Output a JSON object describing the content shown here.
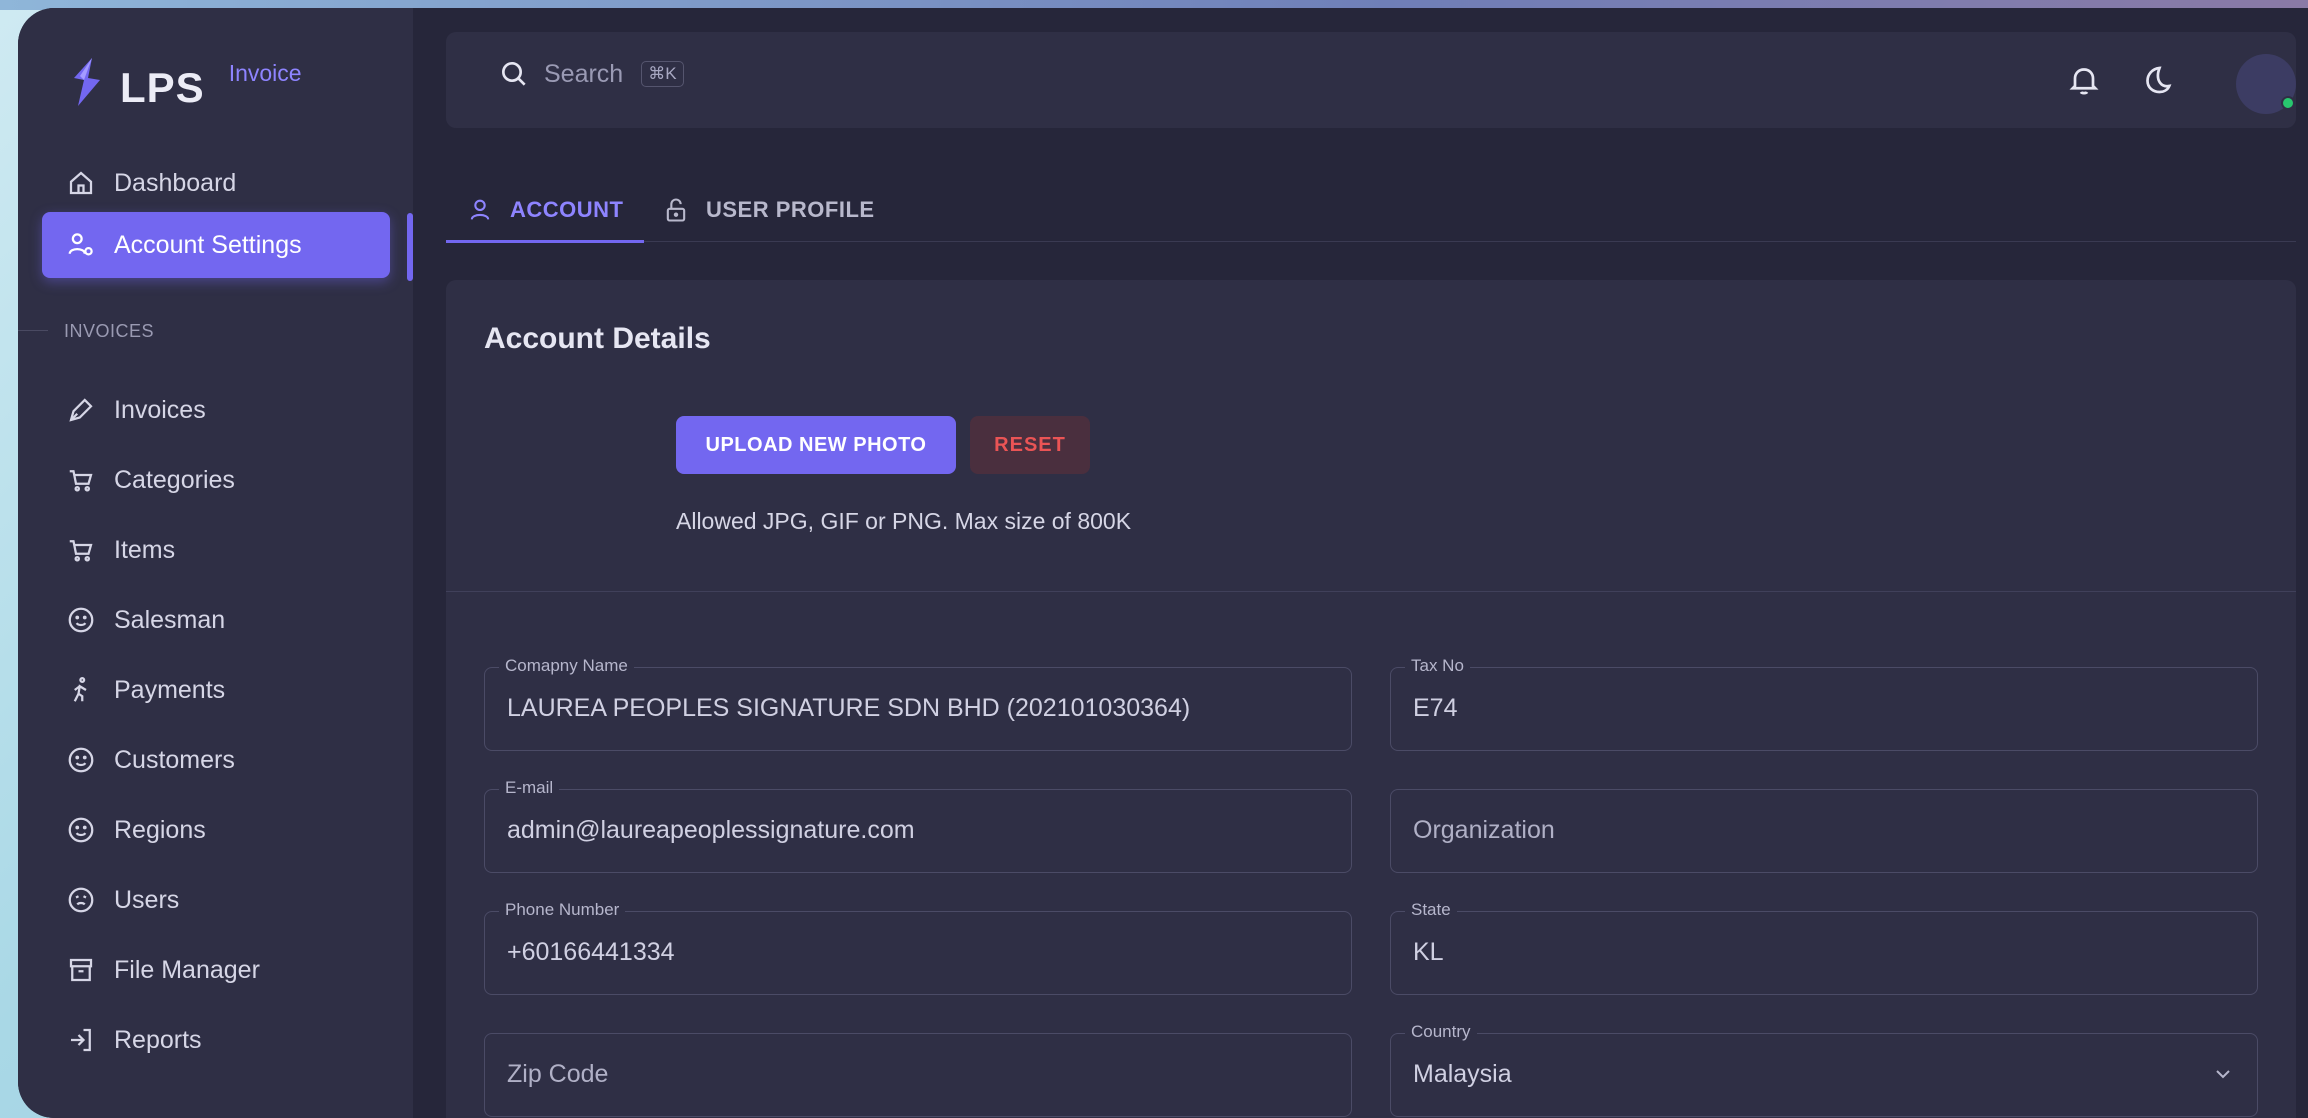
{
  "brand": {
    "name": "LPS",
    "sub": "Invoice"
  },
  "sidebar": {
    "section_label": "INVOICES",
    "items": [
      {
        "label": "Dashboard",
        "icon": "home-icon"
      },
      {
        "label": "Account Settings",
        "icon": "user-gear-icon",
        "active": true
      },
      {
        "label": "Invoices",
        "icon": "pen-icon"
      },
      {
        "label": "Categories",
        "icon": "cart-icon"
      },
      {
        "label": "Items",
        "icon": "cart-icon"
      },
      {
        "label": "Salesman",
        "icon": "smile-icon"
      },
      {
        "label": "Payments",
        "icon": "walking-icon"
      },
      {
        "label": "Customers",
        "icon": "smile-icon"
      },
      {
        "label": "Regions",
        "icon": "smile-icon"
      },
      {
        "label": "Users",
        "icon": "mood-icon"
      },
      {
        "label": "File Manager",
        "icon": "archive-icon"
      },
      {
        "label": "Reports",
        "icon": "login-icon"
      }
    ]
  },
  "topbar": {
    "search_placeholder": "Search",
    "shortcut": "⌘K"
  },
  "tabs": [
    {
      "label": "ACCOUNT",
      "icon": "user-icon",
      "active": true
    },
    {
      "label": "USER PROFILE",
      "icon": "lock-open-icon",
      "active": false
    }
  ],
  "card": {
    "title": "Account Details",
    "upload_button": "UPLOAD NEW PHOTO",
    "reset_button": "RESET",
    "upload_hint": "Allowed JPG, GIF or PNG. Max size of 800K"
  },
  "form": {
    "company": {
      "label": "Comapny Name",
      "value": "LAUREA PEOPLES SIGNATURE SDN BHD (202101030364)"
    },
    "tax": {
      "label": "Tax No",
      "value": "E74"
    },
    "email": {
      "label": "E-mail",
      "value": "admin@laureapeoplessignature.com"
    },
    "organization": {
      "placeholder": "Organization"
    },
    "phone": {
      "label": "Phone Number",
      "value": "+60166441334"
    },
    "state": {
      "label": "State",
      "value": "KL"
    },
    "zip": {
      "placeholder": "Zip Code"
    },
    "country": {
      "label": "Country",
      "value": "Malaysia"
    }
  },
  "colors": {
    "accent": "#7367f0",
    "danger": "#ea5455",
    "online": "#28c76f"
  }
}
